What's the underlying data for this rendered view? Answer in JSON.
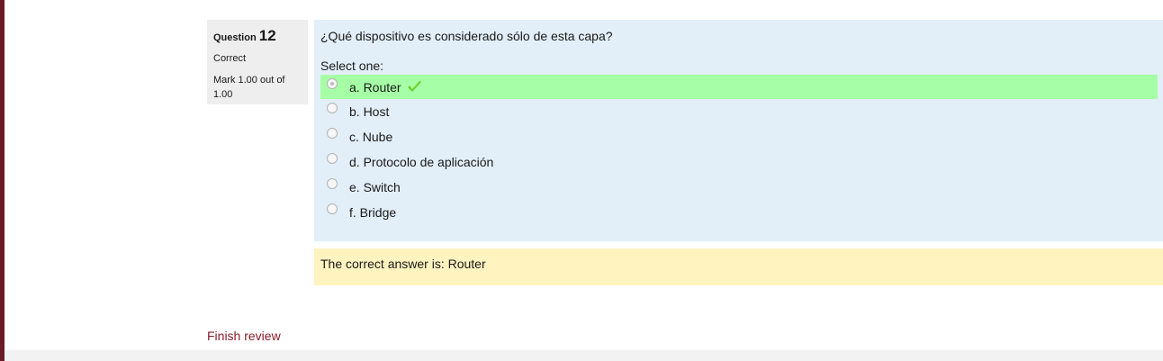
{
  "question": {
    "label": "Question",
    "number": "12",
    "state": "Correct",
    "grade": "Mark 1.00 out of 1.00",
    "text": "¿Qué dispositivo es considerado sólo de esta capa?",
    "prompt": "Select one:",
    "options": [
      {
        "label": "a. Router",
        "selected": true,
        "correct": true
      },
      {
        "label": "b. Host",
        "selected": false,
        "correct": false
      },
      {
        "label": "c. Nube",
        "selected": false,
        "correct": false
      },
      {
        "label": "d. Protocolo de aplicación",
        "selected": false,
        "correct": false
      },
      {
        "label": "e. Switch",
        "selected": false,
        "correct": false
      },
      {
        "label": "f. Bridge",
        "selected": false,
        "correct": false
      }
    ],
    "feedback": "The correct answer is: Router"
  },
  "nav": {
    "finish_label": "Finish review"
  },
  "colors": {
    "accent": "#8b1c2b",
    "correct_bg": "#a6ffa6",
    "formulation_bg": "#e2eef8",
    "feedback_bg": "#fff3bf",
    "check": "#6fcf2b"
  }
}
